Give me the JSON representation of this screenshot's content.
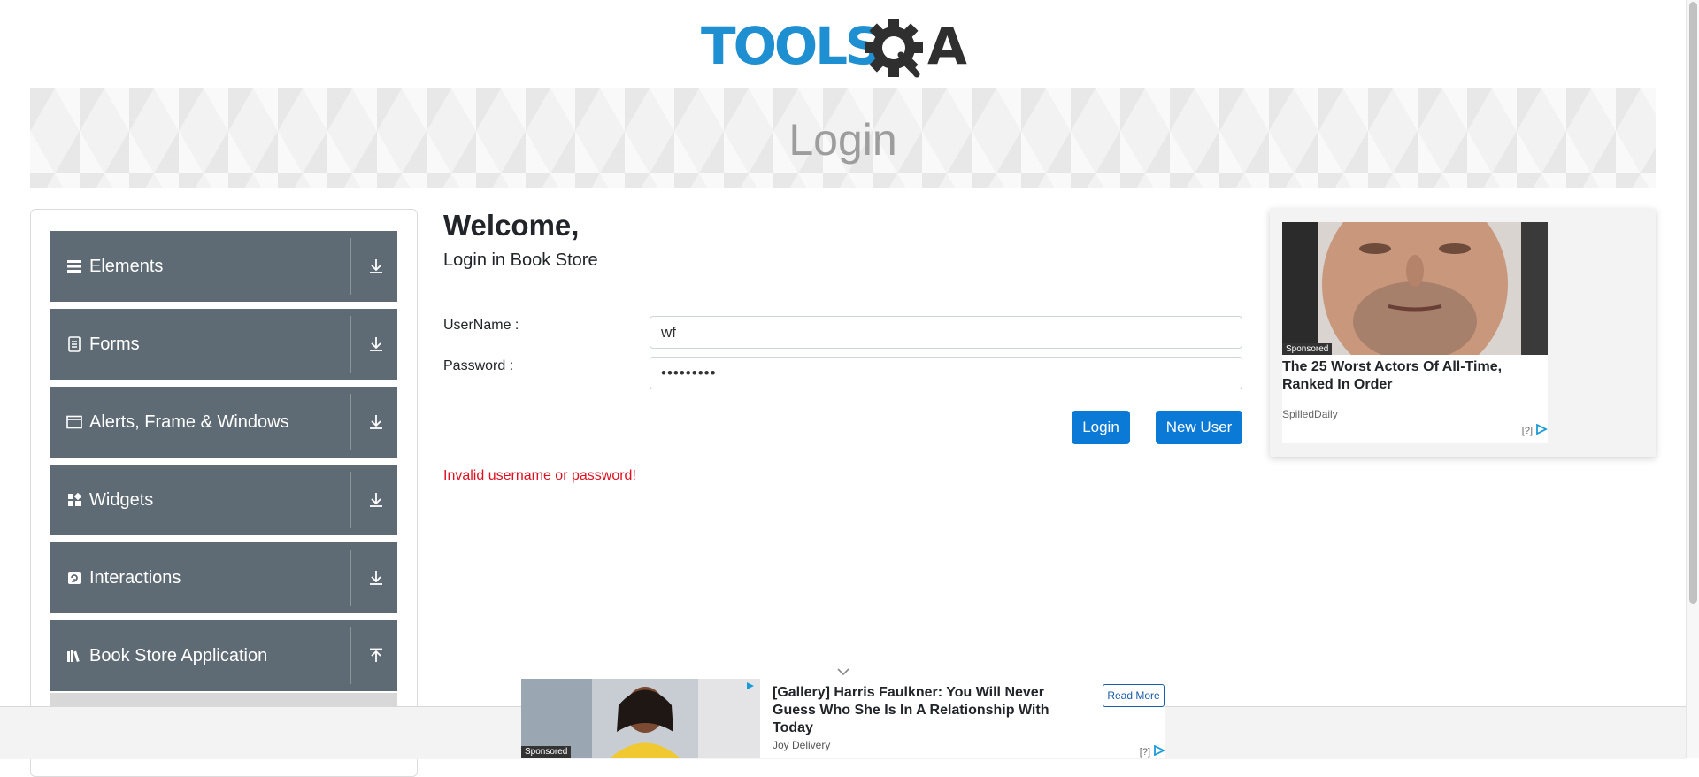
{
  "header": {
    "logo_text_left": "TOOLS",
    "logo_text_right": "A"
  },
  "banner": {
    "title": "Login"
  },
  "sidebar": {
    "groups": [
      {
        "label": "Elements",
        "icon": "menu-lines-icon",
        "arrow": "download-arrow-icon"
      },
      {
        "label": "Forms",
        "icon": "document-icon",
        "arrow": "download-arrow-icon"
      },
      {
        "label": "Alerts, Frame & Windows",
        "icon": "window-icon",
        "arrow": "download-arrow-icon"
      },
      {
        "label": "Widgets",
        "icon": "widgets-icon",
        "arrow": "download-arrow-icon"
      },
      {
        "label": "Interactions",
        "icon": "interactions-icon",
        "arrow": "download-arrow-icon"
      },
      {
        "label": "Book Store Application",
        "icon": "books-icon",
        "arrow": "upload-arrow-icon"
      }
    ],
    "expanded_group": "Book Store Application"
  },
  "main": {
    "welcome": "Welcome,",
    "subtitle": "Login in Book Store",
    "username_label": "UserName :",
    "username_value": "wf",
    "password_label": "Password :",
    "password_value": "•••••••••",
    "login_button": "Login",
    "new_user_button": "New User",
    "error_message": "Invalid username or password!"
  },
  "side_ad": {
    "sponsored": "Sponsored",
    "headline": "The 25 Worst Actors Of All-Time, Ranked In Order",
    "source": "SpilledDaily",
    "info": "[?]"
  },
  "bottom_ad": {
    "sponsored": "Sponsored",
    "headline": "[Gallery] Harris Faulkner: You Will Never Guess Who She Is In A Relationship With Today",
    "source": "Joy Delivery",
    "cta": "Read More",
    "info": "[?]"
  },
  "colors": {
    "brand_blue": "#1e8fd0",
    "brand_dark": "#2f2f2f",
    "accordion_bg": "#5f6b74",
    "button_blue": "#0b7ad6",
    "error_red": "#e01020"
  }
}
